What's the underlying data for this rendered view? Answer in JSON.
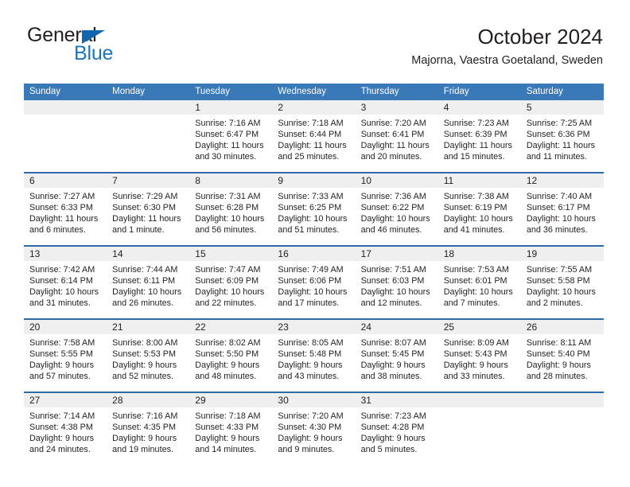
{
  "logo": {
    "word1": "General",
    "word2": "Blue",
    "triangle_color": "#1266b0",
    "word2_color": "#1b75bb"
  },
  "header": {
    "title": "October 2024",
    "subtitle": "Majorna, Vaestra Goetaland, Sweden"
  },
  "theme": {
    "header_bar": "#3a79b8",
    "week_rule": "#2c6aa8",
    "daynum_band": "#efefef",
    "text": "#231f20"
  },
  "weekdays": [
    "Sunday",
    "Monday",
    "Tuesday",
    "Wednesday",
    "Thursday",
    "Friday",
    "Saturday"
  ],
  "weeks": [
    {
      "days": [
        {
          "num": "",
          "lines": [
            "",
            "",
            "",
            ""
          ]
        },
        {
          "num": "",
          "lines": [
            "",
            "",
            "",
            ""
          ]
        },
        {
          "num": "1",
          "lines": [
            "Sunrise: 7:16 AM",
            "Sunset: 6:47 PM",
            "Daylight: 11 hours",
            "and 30 minutes."
          ]
        },
        {
          "num": "2",
          "lines": [
            "Sunrise: 7:18 AM",
            "Sunset: 6:44 PM",
            "Daylight: 11 hours",
            "and 25 minutes."
          ]
        },
        {
          "num": "3",
          "lines": [
            "Sunrise: 7:20 AM",
            "Sunset: 6:41 PM",
            "Daylight: 11 hours",
            "and 20 minutes."
          ]
        },
        {
          "num": "4",
          "lines": [
            "Sunrise: 7:23 AM",
            "Sunset: 6:39 PM",
            "Daylight: 11 hours",
            "and 15 minutes."
          ]
        },
        {
          "num": "5",
          "lines": [
            "Sunrise: 7:25 AM",
            "Sunset: 6:36 PM",
            "Daylight: 11 hours",
            "and 11 minutes."
          ]
        }
      ]
    },
    {
      "days": [
        {
          "num": "6",
          "lines": [
            "Sunrise: 7:27 AM",
            "Sunset: 6:33 PM",
            "Daylight: 11 hours",
            "and 6 minutes."
          ]
        },
        {
          "num": "7",
          "lines": [
            "Sunrise: 7:29 AM",
            "Sunset: 6:30 PM",
            "Daylight: 11 hours",
            "and 1 minute."
          ]
        },
        {
          "num": "8",
          "lines": [
            "Sunrise: 7:31 AM",
            "Sunset: 6:28 PM",
            "Daylight: 10 hours",
            "and 56 minutes."
          ]
        },
        {
          "num": "9",
          "lines": [
            "Sunrise: 7:33 AM",
            "Sunset: 6:25 PM",
            "Daylight: 10 hours",
            "and 51 minutes."
          ]
        },
        {
          "num": "10",
          "lines": [
            "Sunrise: 7:36 AM",
            "Sunset: 6:22 PM",
            "Daylight: 10 hours",
            "and 46 minutes."
          ]
        },
        {
          "num": "11",
          "lines": [
            "Sunrise: 7:38 AM",
            "Sunset: 6:19 PM",
            "Daylight: 10 hours",
            "and 41 minutes."
          ]
        },
        {
          "num": "12",
          "lines": [
            "Sunrise: 7:40 AM",
            "Sunset: 6:17 PM",
            "Daylight: 10 hours",
            "and 36 minutes."
          ]
        }
      ]
    },
    {
      "days": [
        {
          "num": "13",
          "lines": [
            "Sunrise: 7:42 AM",
            "Sunset: 6:14 PM",
            "Daylight: 10 hours",
            "and 31 minutes."
          ]
        },
        {
          "num": "14",
          "lines": [
            "Sunrise: 7:44 AM",
            "Sunset: 6:11 PM",
            "Daylight: 10 hours",
            "and 26 minutes."
          ]
        },
        {
          "num": "15",
          "lines": [
            "Sunrise: 7:47 AM",
            "Sunset: 6:09 PM",
            "Daylight: 10 hours",
            "and 22 minutes."
          ]
        },
        {
          "num": "16",
          "lines": [
            "Sunrise: 7:49 AM",
            "Sunset: 6:06 PM",
            "Daylight: 10 hours",
            "and 17 minutes."
          ]
        },
        {
          "num": "17",
          "lines": [
            "Sunrise: 7:51 AM",
            "Sunset: 6:03 PM",
            "Daylight: 10 hours",
            "and 12 minutes."
          ]
        },
        {
          "num": "18",
          "lines": [
            "Sunrise: 7:53 AM",
            "Sunset: 6:01 PM",
            "Daylight: 10 hours",
            "and 7 minutes."
          ]
        },
        {
          "num": "19",
          "lines": [
            "Sunrise: 7:55 AM",
            "Sunset: 5:58 PM",
            "Daylight: 10 hours",
            "and 2 minutes."
          ]
        }
      ]
    },
    {
      "days": [
        {
          "num": "20",
          "lines": [
            "Sunrise: 7:58 AM",
            "Sunset: 5:55 PM",
            "Daylight: 9 hours",
            "and 57 minutes."
          ]
        },
        {
          "num": "21",
          "lines": [
            "Sunrise: 8:00 AM",
            "Sunset: 5:53 PM",
            "Daylight: 9 hours",
            "and 52 minutes."
          ]
        },
        {
          "num": "22",
          "lines": [
            "Sunrise: 8:02 AM",
            "Sunset: 5:50 PM",
            "Daylight: 9 hours",
            "and 48 minutes."
          ]
        },
        {
          "num": "23",
          "lines": [
            "Sunrise: 8:05 AM",
            "Sunset: 5:48 PM",
            "Daylight: 9 hours",
            "and 43 minutes."
          ]
        },
        {
          "num": "24",
          "lines": [
            "Sunrise: 8:07 AM",
            "Sunset: 5:45 PM",
            "Daylight: 9 hours",
            "and 38 minutes."
          ]
        },
        {
          "num": "25",
          "lines": [
            "Sunrise: 8:09 AM",
            "Sunset: 5:43 PM",
            "Daylight: 9 hours",
            "and 33 minutes."
          ]
        },
        {
          "num": "26",
          "lines": [
            "Sunrise: 8:11 AM",
            "Sunset: 5:40 PM",
            "Daylight: 9 hours",
            "and 28 minutes."
          ]
        }
      ]
    },
    {
      "days": [
        {
          "num": "27",
          "lines": [
            "Sunrise: 7:14 AM",
            "Sunset: 4:38 PM",
            "Daylight: 9 hours",
            "and 24 minutes."
          ]
        },
        {
          "num": "28",
          "lines": [
            "Sunrise: 7:16 AM",
            "Sunset: 4:35 PM",
            "Daylight: 9 hours",
            "and 19 minutes."
          ]
        },
        {
          "num": "29",
          "lines": [
            "Sunrise: 7:18 AM",
            "Sunset: 4:33 PM",
            "Daylight: 9 hours",
            "and 14 minutes."
          ]
        },
        {
          "num": "30",
          "lines": [
            "Sunrise: 7:20 AM",
            "Sunset: 4:30 PM",
            "Daylight: 9 hours",
            "and 9 minutes."
          ]
        },
        {
          "num": "31",
          "lines": [
            "Sunrise: 7:23 AM",
            "Sunset: 4:28 PM",
            "Daylight: 9 hours",
            "and 5 minutes."
          ]
        },
        {
          "num": "",
          "lines": [
            "",
            "",
            "",
            ""
          ]
        },
        {
          "num": "",
          "lines": [
            "",
            "",
            "",
            ""
          ]
        }
      ]
    }
  ]
}
